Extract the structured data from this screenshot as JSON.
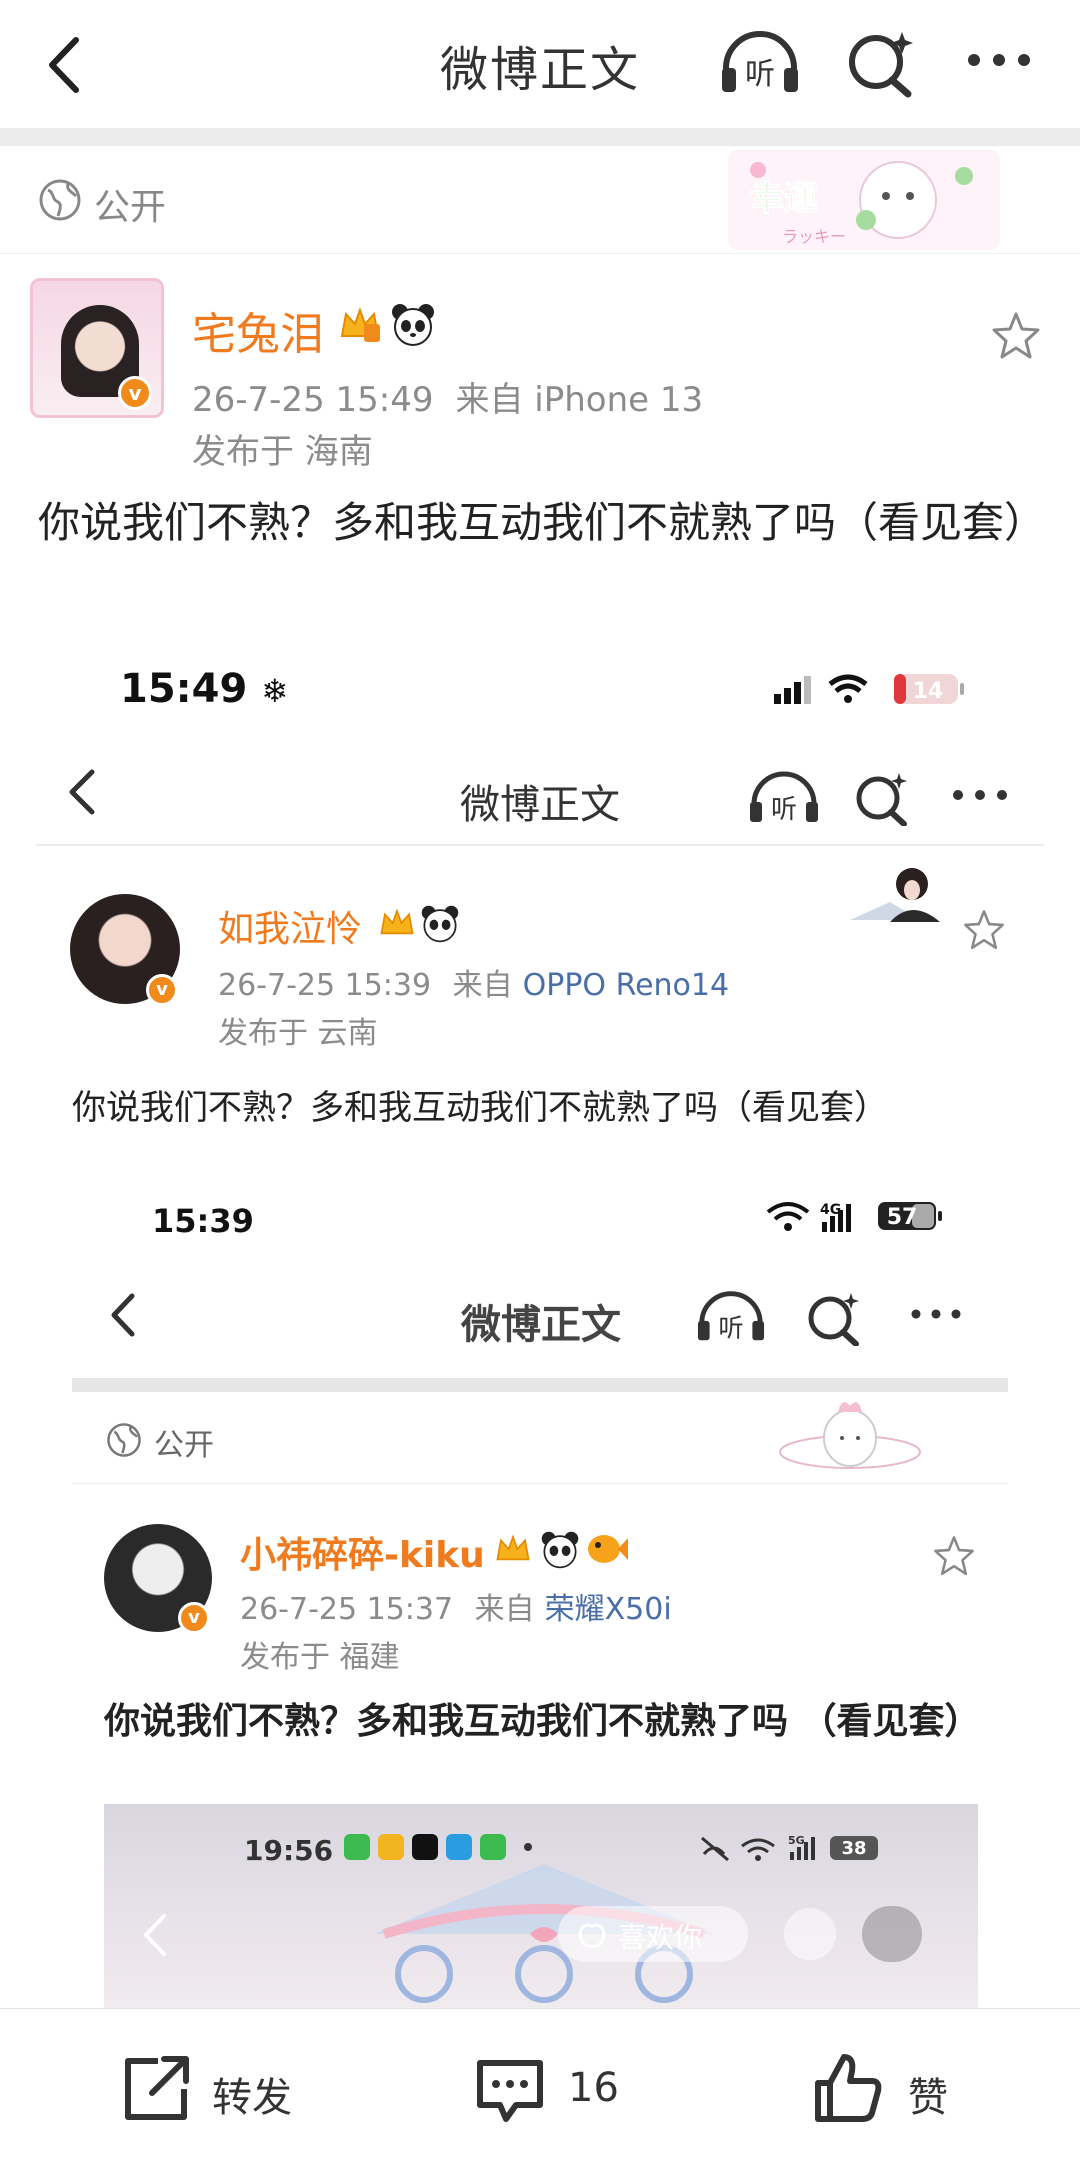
{
  "header": {
    "title": "微博正文"
  },
  "post": {
    "visibility": "公开",
    "username": "宅兔泪",
    "timestamp": "26-7-25 15:49",
    "source": "来自 iPhone 13",
    "location": "发布于 海南",
    "text": "你说我们不熟？多和我互动我们不就熟了吗（看见套）",
    "deco_label": "幸運",
    "deco_sub": "ラッキー"
  },
  "embed1": {
    "status_time": "15:49",
    "battery": "14",
    "header_title": "微博正文",
    "username": "如我泣怜",
    "timestamp": "26-7-25 15:39",
    "source_prefix": "来自",
    "source_device": "OPPO Reno14",
    "location": "发布于 云南",
    "text": "你说我们不熟？多和我互动我们不就熟了吗（看见套）"
  },
  "embed2": {
    "status_time": "15:39",
    "battery": "57",
    "network": "4G",
    "header_title": "微博正文",
    "visibility": "公开",
    "username": "小祎碎碎-kiku",
    "timestamp": "26-7-25 15:37",
    "source_prefix": "来自",
    "source_device": "荣耀X50i",
    "location": "发布于 福建",
    "text": "你说我们不熟？多和我互动我们不就熟了吗 （看见套）"
  },
  "embed3": {
    "status_time": "19:56",
    "battery": "38",
    "network": "5G",
    "like_label": "喜欢你"
  },
  "bottom_bar": {
    "repost_label": "转发",
    "comment_count": "16",
    "like_label": "赞"
  },
  "colors": {
    "username": "#f07b1e",
    "device_link": "#4a6fa8",
    "meta": "#8b8b8b",
    "verified_badge": "#f08a1a"
  },
  "icons": [
    "back-icon",
    "listen-icon",
    "super-topic-icon",
    "more-icon",
    "globe-icon",
    "crown-icon",
    "panda-icon",
    "star-outline-icon",
    "repost-icon",
    "comment-icon",
    "thumbs-up-icon"
  ]
}
